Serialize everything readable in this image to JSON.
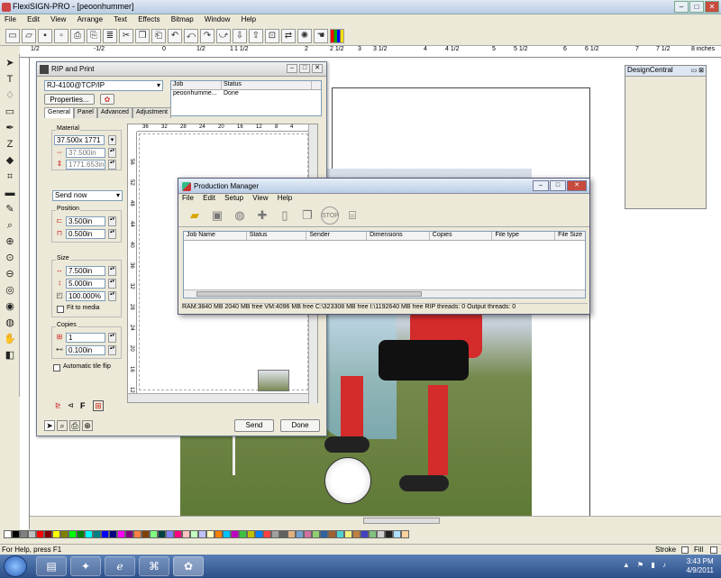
{
  "app": {
    "title": "FlexiSIGN-PRO - [peoonhummer]",
    "window_buttons": [
      "–",
      "□",
      "✕"
    ]
  },
  "menubar": [
    "File",
    "Edit",
    "View",
    "Arrange",
    "Text",
    "Effects",
    "Bitmap",
    "Window",
    "Help"
  ],
  "ruler_labels": [
    "1/2",
    "-1/2",
    "0",
    "1/2",
    "1",
    "1 1/2",
    "2",
    "2 1/2",
    "3",
    "3 1/2",
    "4",
    "4 1/2",
    "5",
    "5 1/2",
    "6",
    "6 1/2",
    "7",
    "7 1/2",
    "8 inches"
  ],
  "design_central": {
    "title": "DesignCentral"
  },
  "rip": {
    "title": "RIP and Print",
    "device": "RJ-4100@TCP/IP",
    "properties_button": "Properties...",
    "tabs": [
      "General",
      "Panel",
      "Advanced",
      "Adjustment"
    ],
    "job_header": [
      "Job",
      "Status"
    ],
    "job_row": [
      "peoonhumme...",
      "Done"
    ],
    "material_label": "Material",
    "material_value": "37.500x 1771",
    "width_value": "37.500in",
    "height_value": "1771.653in",
    "send_mode": "Send now",
    "position_label": "Position",
    "pos_x": "3.500in",
    "pos_y": "0.500in",
    "size_label": "Size",
    "size_w": "7.500in",
    "size_h": "5.000in",
    "scale": "100.000%",
    "fit_to_media": "Fit to media",
    "copies_label": "Copies",
    "copies_value": "1",
    "copies_gap": "0.100in",
    "auto_tile_flip": "Automatic tile flip",
    "send_button": "Send",
    "done_button": "Done",
    "preview_top_ruler": [
      "36",
      "32",
      "28",
      "24",
      "20",
      "16",
      "12",
      "8",
      "4"
    ],
    "preview_left_ruler": [
      "56",
      "52",
      "48",
      "44",
      "40",
      "36",
      "32",
      "28",
      "24",
      "20",
      "16",
      "12"
    ]
  },
  "pm": {
    "title": "Production Manager",
    "menu": [
      "File",
      "Edit",
      "Setup",
      "View",
      "Help"
    ],
    "columns": [
      "Job Name",
      "Status",
      "Sender",
      "Dimensions",
      "Copies",
      "File type",
      "File Size"
    ],
    "status": "RAM:3840 MB 2040 MB free VM:4096 MB free C:\\323308 MB free I:\\1192640 MB free RIP threads: 0 Output threads: 0"
  },
  "statusbar": {
    "help": "For Help, press F1",
    "stroke": "Stroke",
    "fill": "Fill"
  },
  "clock": {
    "time": "3:43 PM",
    "date": "4/9/2011"
  },
  "palette_colors": [
    "#ffffff",
    "#000000",
    "#808080",
    "#c0c0c0",
    "#ff0000",
    "#800000",
    "#ffff00",
    "#808000",
    "#00ff00",
    "#008000",
    "#00ffff",
    "#008080",
    "#0000ff",
    "#000080",
    "#ff00ff",
    "#800080",
    "#ff8040",
    "#804000",
    "#80ff80",
    "#004040",
    "#8080ff",
    "#ff0080",
    "#ffc0c0",
    "#c0ffc0",
    "#c0c0ff",
    "#ffffc0",
    "#ff8000",
    "#00c0ff",
    "#c000c0",
    "#40c040",
    "#c0c000",
    "#0080ff",
    "#ff4040",
    "#a0a0a0",
    "#606060",
    "#e0b080",
    "#70a0d0",
    "#d070a0",
    "#90d070",
    "#3060a0",
    "#a06030",
    "#50d0d0",
    "#f0f080",
    "#c08040",
    "#4040c0",
    "#80c080",
    "#d0d0d0",
    "#202020",
    "#b0e0ff",
    "#ffd0a0"
  ]
}
